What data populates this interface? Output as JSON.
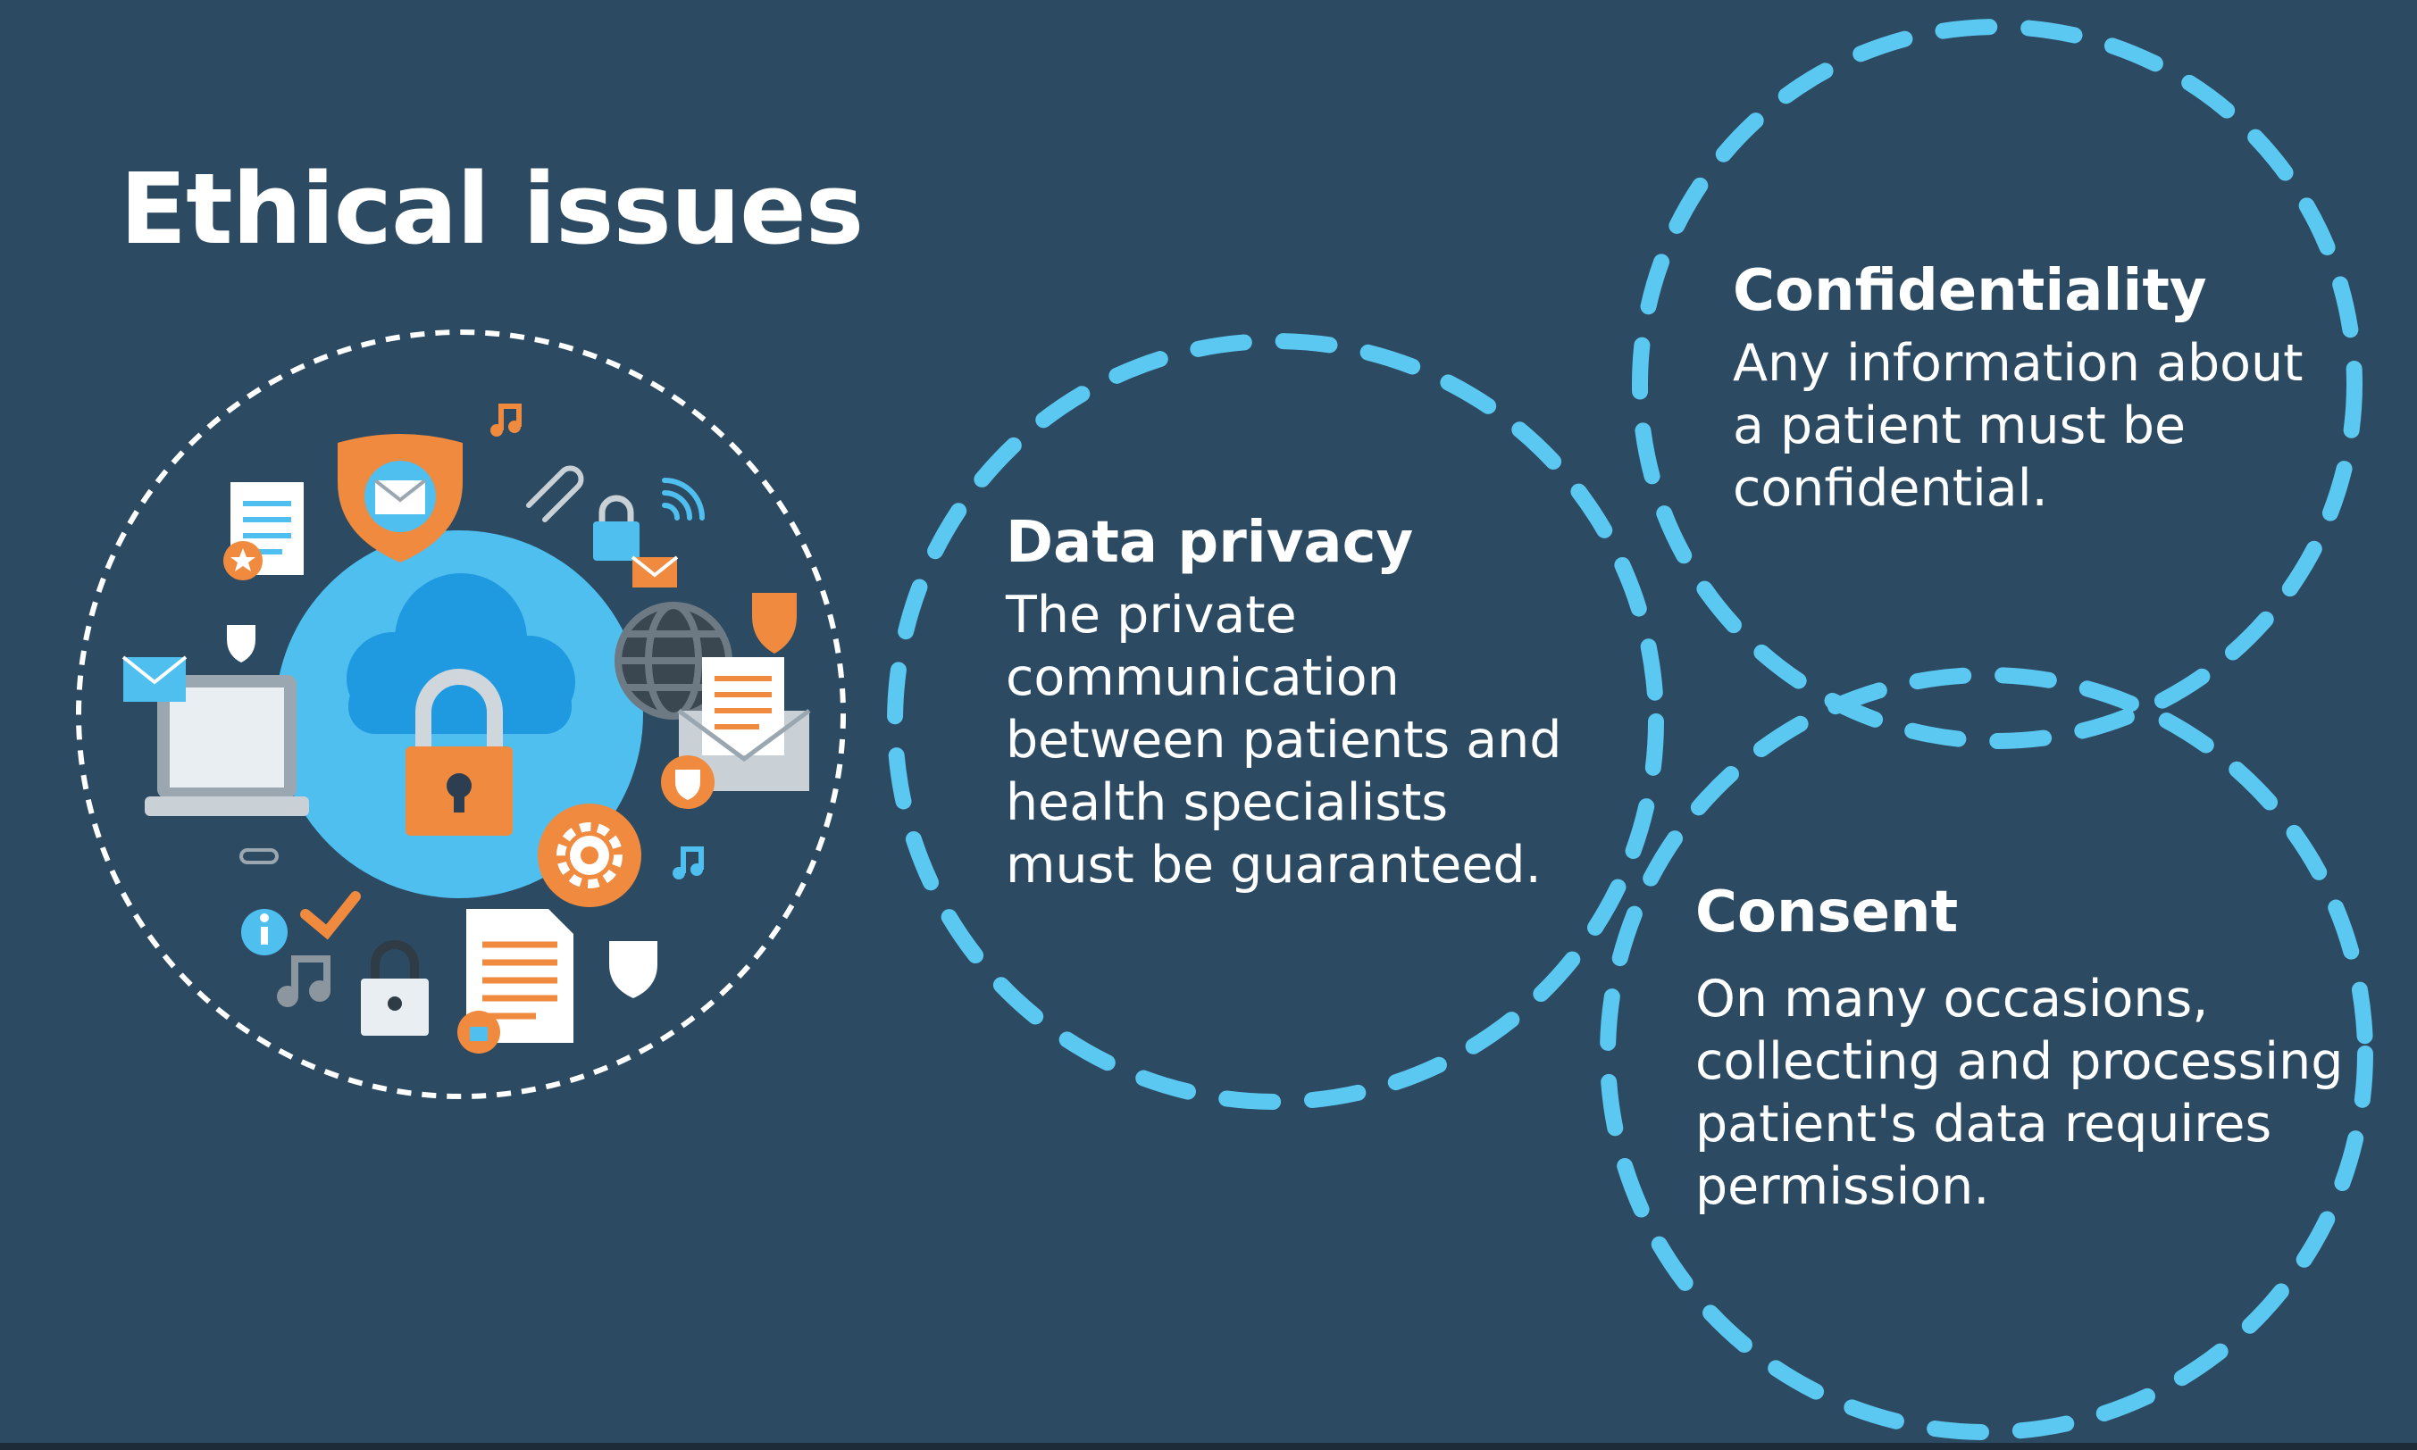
{
  "title": "Ethical issues",
  "colors": {
    "background": "#2c4a62",
    "dashed_circle": "#5bc8f2",
    "illustration_ring": "#ffffff",
    "accent_orange": "#f08a3e",
    "accent_blue": "#4fbff0"
  },
  "illustration": {
    "icons": [
      "cloud-icon",
      "padlock-icon",
      "shield-mail-icon",
      "document-icon",
      "envelope-icon",
      "laptop-icon",
      "globe-icon",
      "gear-icon",
      "music-note-icon",
      "paperclip-icon",
      "wifi-icon",
      "info-icon",
      "checkmark-icon",
      "shield-icon"
    ]
  },
  "topics": [
    {
      "id": "privacy",
      "heading": "Data privacy",
      "lines": [
        "The private",
        "communication",
        "between patients and",
        "health specialists",
        "must be guaranteed."
      ]
    },
    {
      "id": "confidentiality",
      "heading": "Confidentiality",
      "lines": [
        "Any information about",
        "a patient must be",
        "confidential."
      ]
    },
    {
      "id": "consent",
      "heading": "Consent",
      "lines": [
        "On many occasions,",
        "collecting and processing",
        "patient's data requires",
        "permission."
      ]
    }
  ]
}
